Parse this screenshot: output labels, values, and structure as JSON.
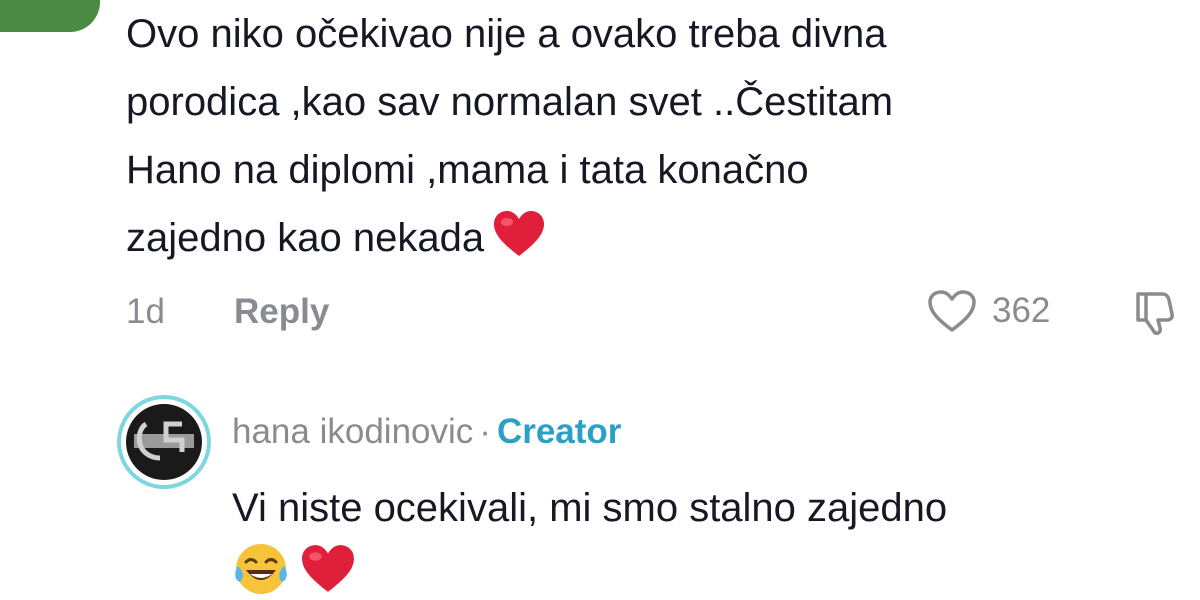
{
  "comment": {
    "text_lines": [
      "Ovo niko očekivao nije a ovako treba divna",
      "porodica ,kao sav normalan svet ..Čestitam",
      "Hano na diplomi ,mama i tata konačno",
      "zajedno kao nekada"
    ],
    "emoji": "heart-emoji",
    "time": "1d",
    "reply_label": "Reply",
    "like_count": "362",
    "avatar_color": "#4b8a45"
  },
  "reply": {
    "author": "hana ikodinovic",
    "separator": "·",
    "badge": "Creator",
    "badge_color": "#2aa0c4",
    "text": "Vi niste ocekivali, mi smo stalno zajedno",
    "emojis": [
      "laughing-tears-emoji",
      "heart-emoji"
    ]
  }
}
